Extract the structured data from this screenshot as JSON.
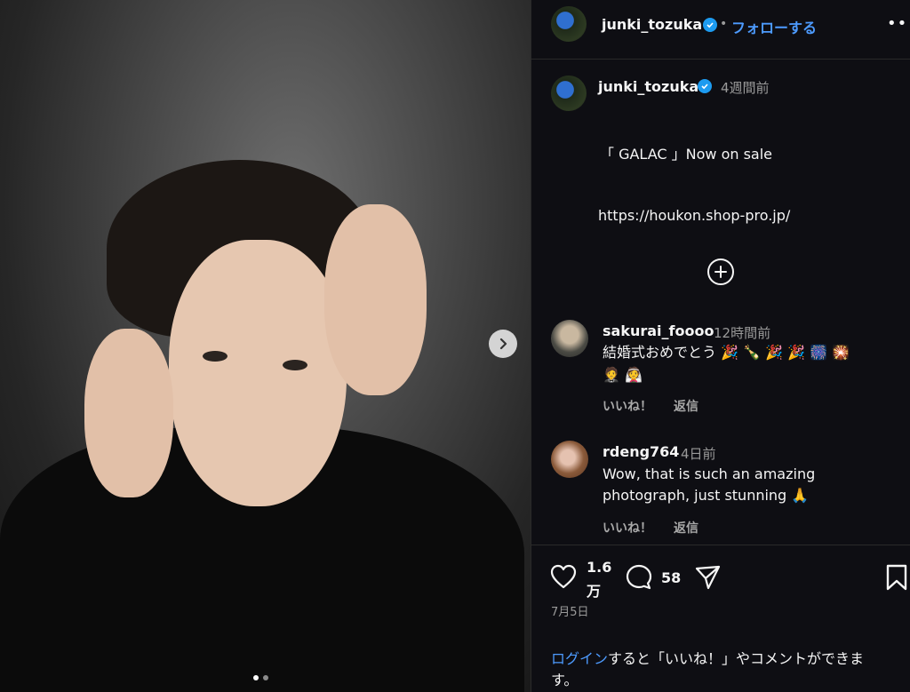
{
  "header": {
    "username": "junki_tozuka",
    "separator": "•",
    "follow_label": "フォローする",
    "more_label": "•••"
  },
  "post": {
    "username": "junki_tozuka",
    "time_ago": "4週間前",
    "caption_line1": "「 GALAC 」Now on sale",
    "caption_line2": "https://houkon.shop-pro.jp/"
  },
  "comments": [
    {
      "username": "sakurai_foooo",
      "time_ago": "12時間前",
      "text": "結婚式おめでとう 🎉 🍾 🎉 🎉 🎆 🎇",
      "text2": "🤵 👰",
      "like_label": "いいね！",
      "reply_label": "返信"
    },
    {
      "username": "rdeng764",
      "time_ago": "4日前",
      "text": "Wow, that is such an amazing",
      "text2": "photograph, just stunning 🙏",
      "like_label": "いいね！",
      "reply_label": "返信"
    }
  ],
  "actions": {
    "likes_line1": "1.6",
    "likes_line2": "万",
    "comment_count": "58"
  },
  "date": "7月5日",
  "login_prompt": {
    "link": "ログイン",
    "rest": "すると「いいね！」やコメントができま",
    "rest2": "す。"
  },
  "carousel": {
    "slide_count": 2,
    "active_index": 0
  },
  "colors": {
    "accent": "#4d9bff",
    "verified": "#1d9bf0",
    "panel_bg": "#0e0e13"
  }
}
